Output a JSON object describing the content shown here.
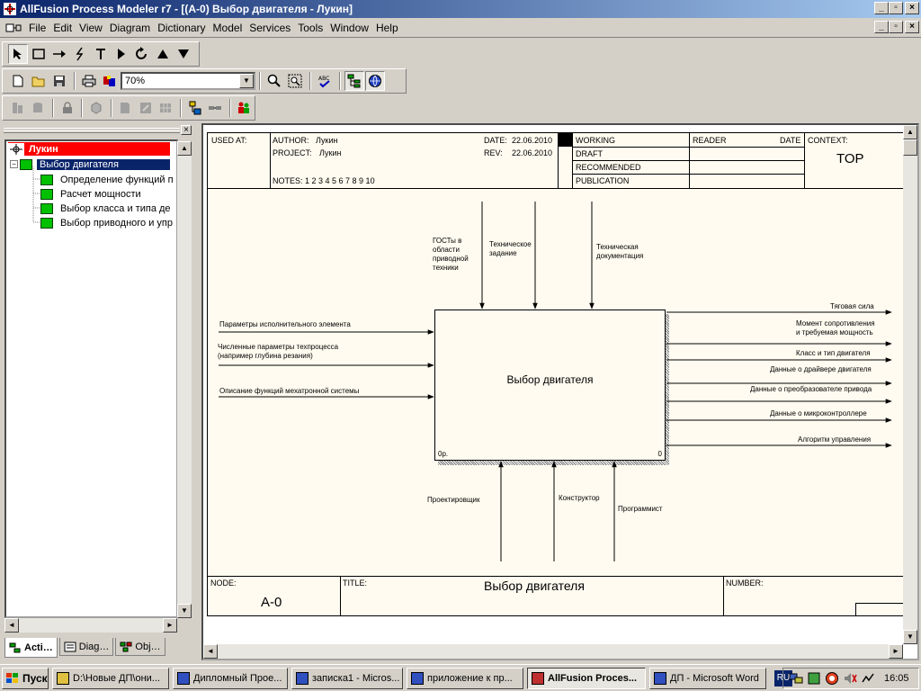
{
  "window": {
    "title": "AllFusion Process Modeler r7 - [(A-0) Выбор двигателя - Лукин]"
  },
  "menu": {
    "items": [
      "File",
      "Edit",
      "View",
      "Diagram",
      "Dictionary",
      "Model",
      "Services",
      "Tools",
      "Window",
      "Help"
    ]
  },
  "toolbar": {
    "zoom_value": "70%"
  },
  "tree": {
    "root": "Лукин",
    "selected": "Выбор двигателя",
    "children": [
      "Определение функций п",
      "Расчет мощности",
      "Выбор класса и типа де",
      "Выбор приводного и упр"
    ]
  },
  "tabs": [
    "Acti…",
    "Diag…",
    "Obj…"
  ],
  "diagram": {
    "header": {
      "used_at": "USED AT:",
      "author_label": "AUTHOR:",
      "author": "Лукин",
      "project_label": "PROJECT:",
      "project": "Лукин",
      "date_label": "DATE:",
      "date": "22.06.2010",
      "rev_label": "REV:",
      "rev": "22.06.2010",
      "notes": "NOTES:  1  2  3  4  5  6  7  8  9  10",
      "status": [
        "WORKING",
        "DRAFT",
        "RECOMMENDED",
        "PUBLICATION"
      ],
      "reader": "READER",
      "date2": "DATE",
      "context_label": "CONTEXT:",
      "context": "TOP"
    },
    "activity": {
      "name": "Выбор двигателя",
      "cost": "0р.",
      "number": "0"
    },
    "controls": [
      "ГОСТы в\nобласти\nприводной\nтехники",
      "Техническое\nзадание",
      "Техническая\nдокументация"
    ],
    "inputs": [
      "Параметры исполнительного элемента",
      "Численные параметры техпроцесса\n(например глубина резания)",
      "Описание функций мехатронной системы"
    ],
    "outputs": [
      "Тяговая сила",
      "Момент сопротивления\nи требуемая мощность",
      "Класс и тип двигателя",
      "Данные о драйвере двигателя",
      "Данные о преобразователе привода",
      "Данные о  микроконтроллере",
      "Алгоритм управления"
    ],
    "mechanisms": [
      "Проектировщик",
      "Конструктор",
      "Программист"
    ],
    "footer": {
      "node_label": "NODE:",
      "node": "A-0",
      "title_label": "TITLE:",
      "title": "Выбор двигателя",
      "number_label": "NUMBER:"
    }
  },
  "taskbar": {
    "start": "Пуск",
    "tasks": [
      "D:\\Новые ДП\\они...",
      "Дипломный Прое...",
      "записка1 - Micros...",
      "приложение к пр...",
      "AllFusion Proces...",
      "ДП - Microsoft Word"
    ],
    "lang": "RU",
    "clock": "16:05"
  },
  "colors": {
    "title_start": "#0a246a",
    "root_highlight": "#ff0000",
    "selected": "#0a246a",
    "node_green": "#00c000",
    "sheet_bg": "#fffbf0"
  }
}
